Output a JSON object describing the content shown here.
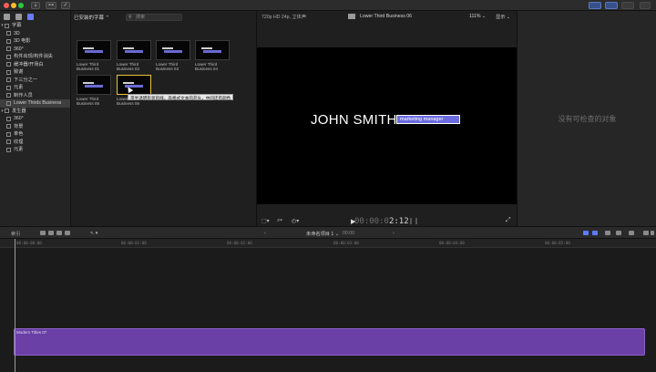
{
  "titlebar": {
    "colors": {
      "close": "#fe5f57",
      "minimize": "#febc2e",
      "zoom": "#28c840",
      "accent": "#6b7bff"
    }
  },
  "sidebar": {
    "items": [
      {
        "label": "字幕",
        "level": 0,
        "expanded": true
      },
      {
        "label": "3D",
        "level": 1
      },
      {
        "label": "3D 电影",
        "level": 1
      },
      {
        "label": "360°",
        "level": 1
      },
      {
        "label": "构件出现/构件消失",
        "level": 1
      },
      {
        "label": "缓冲器/开场白",
        "level": 1
      },
      {
        "label": "致谢",
        "level": 1
      },
      {
        "label": "下三分之一",
        "level": 1
      },
      {
        "label": "元素",
        "level": 1
      },
      {
        "label": "制作人员",
        "level": 1
      },
      {
        "label": "Lower Thirds Business",
        "level": 1,
        "selected": true
      },
      {
        "label": "发生器",
        "level": 0,
        "expanded": true
      },
      {
        "label": "360°",
        "level": 1
      },
      {
        "label": "背景",
        "level": 1
      },
      {
        "label": "单色",
        "level": 1
      },
      {
        "label": "纹理",
        "level": 1
      },
      {
        "label": "元素",
        "level": 1
      }
    ]
  },
  "browser": {
    "header": "已安装的字幕 ⌃",
    "search_placeholder": "搜索",
    "clips": [
      {
        "line1": "Lower Third",
        "line2": "Business 01"
      },
      {
        "line1": "Lower Third",
        "line2": "Business 02"
      },
      {
        "line1": "Lower Third",
        "line2": "Business 03"
      },
      {
        "line1": "Lower Third",
        "line2": "Business 04"
      },
      {
        "line1": "Lower Third",
        "line2": "Business 05"
      },
      {
        "line1": "Lower",
        "line2": "Business 06"
      }
    ],
    "tooltip": "带半透明形状的线，高格式文本的开头，中间还有颜色"
  },
  "viewer": {
    "format": "720p HD 24p, 立体声",
    "clip_title": "Lower Third Business 06",
    "zoom": "111% ⌄",
    "display": "显示 ⌄",
    "name_text": "JOHN SMITH",
    "role_text": "marketing manager",
    "timecode_dim": "00:00:0",
    "timecode_bright": "2:12"
  },
  "inspector": {
    "empty_text": "没有可检查的对象"
  },
  "timeline": {
    "index_label": "索引",
    "project_name": "未命名项目 1 ⌄",
    "duration": "00:00",
    "ruler": [
      "00:00:00:00",
      "00:00:01:00",
      "00:00:02:00",
      "00:00:03:00",
      "00:00:04:00",
      "00:00:05:00"
    ],
    "clip_label": "Modern Titles 07",
    "clip_color": "#6a3fa6"
  }
}
